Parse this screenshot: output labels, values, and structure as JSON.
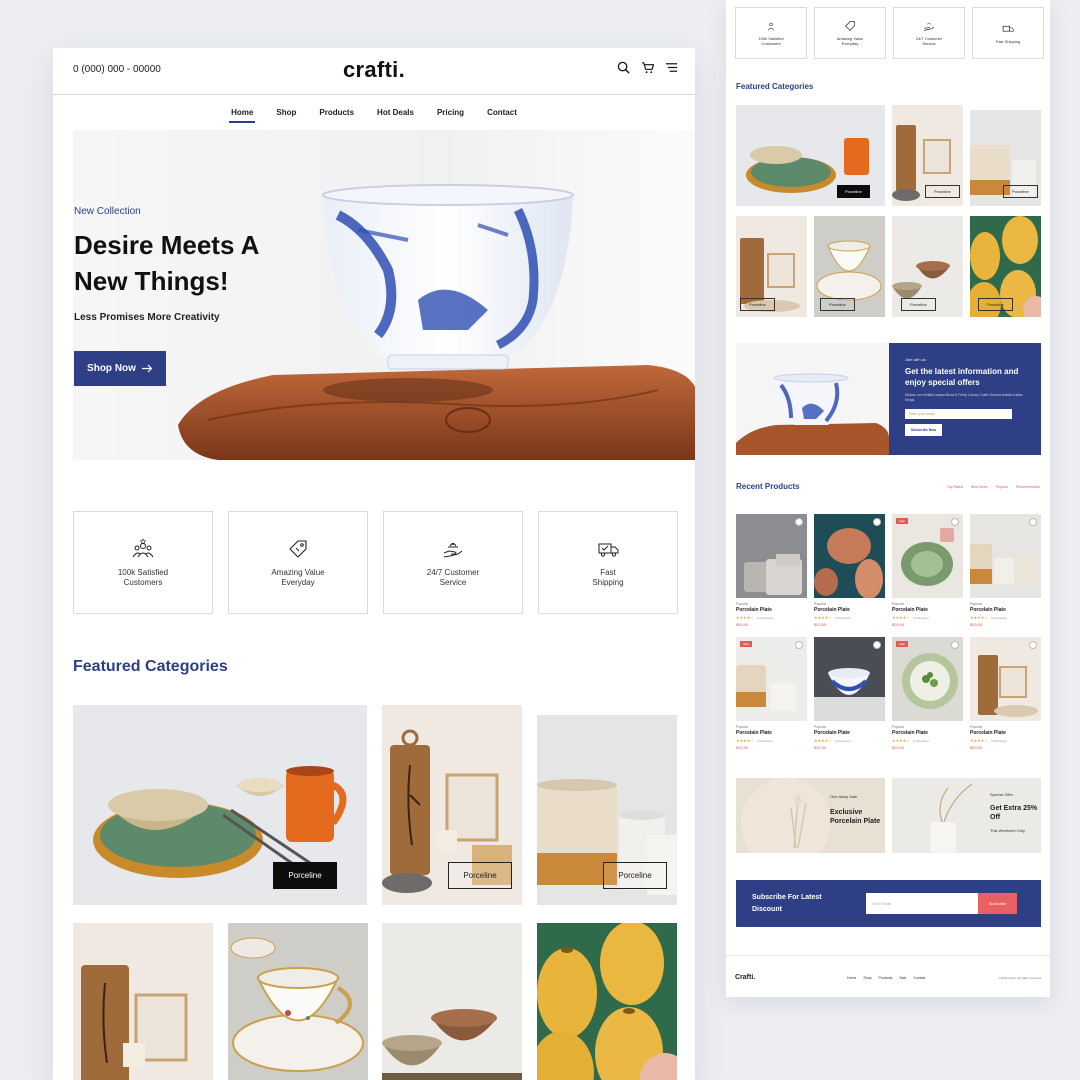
{
  "header": {
    "phone": "0 (000) 000 - 00000",
    "logo": "crafti.",
    "icons": [
      "search-icon",
      "cart-icon",
      "menu-icon"
    ]
  },
  "nav": {
    "items": [
      {
        "label": "Home",
        "active": true
      },
      {
        "label": "Shop"
      },
      {
        "label": "Products"
      },
      {
        "label": "Hot Deals"
      },
      {
        "label": "Pricing"
      },
      {
        "label": "Contact"
      }
    ]
  },
  "hero": {
    "label": "New Collection",
    "title_line1": "Desire Meets A",
    "title_line2": "New Things!",
    "subtitle": "Less Promises More Creativity",
    "button": "Shop Now"
  },
  "features": [
    {
      "line1": "100k Satisfied",
      "line2": "Customers",
      "icon": "people-icon"
    },
    {
      "line1": "Amazing Value",
      "line2": "Everyday",
      "icon": "tag-icon"
    },
    {
      "line1": "24/7 Customer",
      "line2": "Service",
      "icon": "support-icon"
    },
    {
      "line1": "Fast",
      "line2": "Shipping",
      "icon": "truck-icon"
    }
  ],
  "featured": {
    "title": "Featured Categories",
    "button_label": "Porceline"
  },
  "preview": {
    "features": [
      {
        "line1": "100k Satisfied",
        "line2": "Customers"
      },
      {
        "line1": "Amazing Value",
        "line2": "Everyday"
      },
      {
        "line1": "24/7 Customer",
        "line2": "Service"
      },
      {
        "line1": "Fast",
        "line2": "Shipping"
      }
    ],
    "featured_title": "Featured Categories",
    "button_label": "Porceline",
    "newsletter": {
      "small": "Join with us",
      "head": "Get the latest information and enjoy special offers",
      "desc": "Dictum non frintilla massa Bicat & Fredy Luxury Craftz Decora tralala a sties things",
      "placeholder": "Enter your email",
      "button": "Subscribe Now"
    },
    "recent_title": "Recent Products",
    "tabs": [
      "Top Rated",
      "Best Seller",
      "Popular",
      "Recommended"
    ],
    "products": [
      {
        "cat": "Popular",
        "name": "Porcelain Plate",
        "stars": "★★★★☆",
        "reviews": "(4 Reviews)",
        "price": "$20.00"
      },
      {
        "cat": "Popular",
        "name": "Porcelain Plate",
        "stars": "★★★★☆",
        "reviews": "(4 Reviews)",
        "price": "$20.00"
      },
      {
        "cat": "Popular",
        "name": "Porcelain Plate",
        "stars": "★★★★☆",
        "reviews": "(4 Reviews)",
        "price": "$20.00",
        "sale": "Sale"
      },
      {
        "cat": "Popular",
        "name": "Porcelain Plate",
        "stars": "★★★★☆",
        "reviews": "(4 Reviews)",
        "price": "$20.00"
      },
      {
        "cat": "Popular",
        "name": "Porcelain Plate",
        "stars": "★★★★☆",
        "reviews": "(4 Reviews)",
        "price": "$20.00",
        "sale": "Sale"
      },
      {
        "cat": "Popular",
        "name": "Porcelain Plate",
        "stars": "★★★★☆",
        "reviews": "(4 Reviews)",
        "price": "$20.00"
      },
      {
        "cat": "Popular",
        "name": "Porcelain Plate",
        "stars": "★★★★☆",
        "reviews": "(4 Reviews)",
        "price": "$20.00",
        "sale": "Sale"
      },
      {
        "cat": "Popular",
        "name": "Porcelain Plate",
        "stars": "★★★★☆",
        "reviews": "(4 Reviews)",
        "price": "$20.00"
      }
    ],
    "offer1": {
      "small": "One Away Sale",
      "big": "Exclusive Porcelain Plate"
    },
    "offer2": {
      "small": "Special Offer",
      "big": "Get Extra 25% Off",
      "tiny": "This Weekend Only"
    },
    "subscribe": {
      "title": "Subscribe For Latest Discount",
      "placeholder": "Your Email",
      "button": "Subscribe"
    },
    "footer": {
      "logo": "Crafti.",
      "links": [
        "Home",
        "Shop",
        "Products",
        "Sale",
        "Contact"
      ],
      "copy": "©2022 Crafti. All rights reserved"
    }
  },
  "colors": {
    "accent": "#2e3f86",
    "sale": "#e05a5a",
    "terracotta": "#a8552b"
  }
}
